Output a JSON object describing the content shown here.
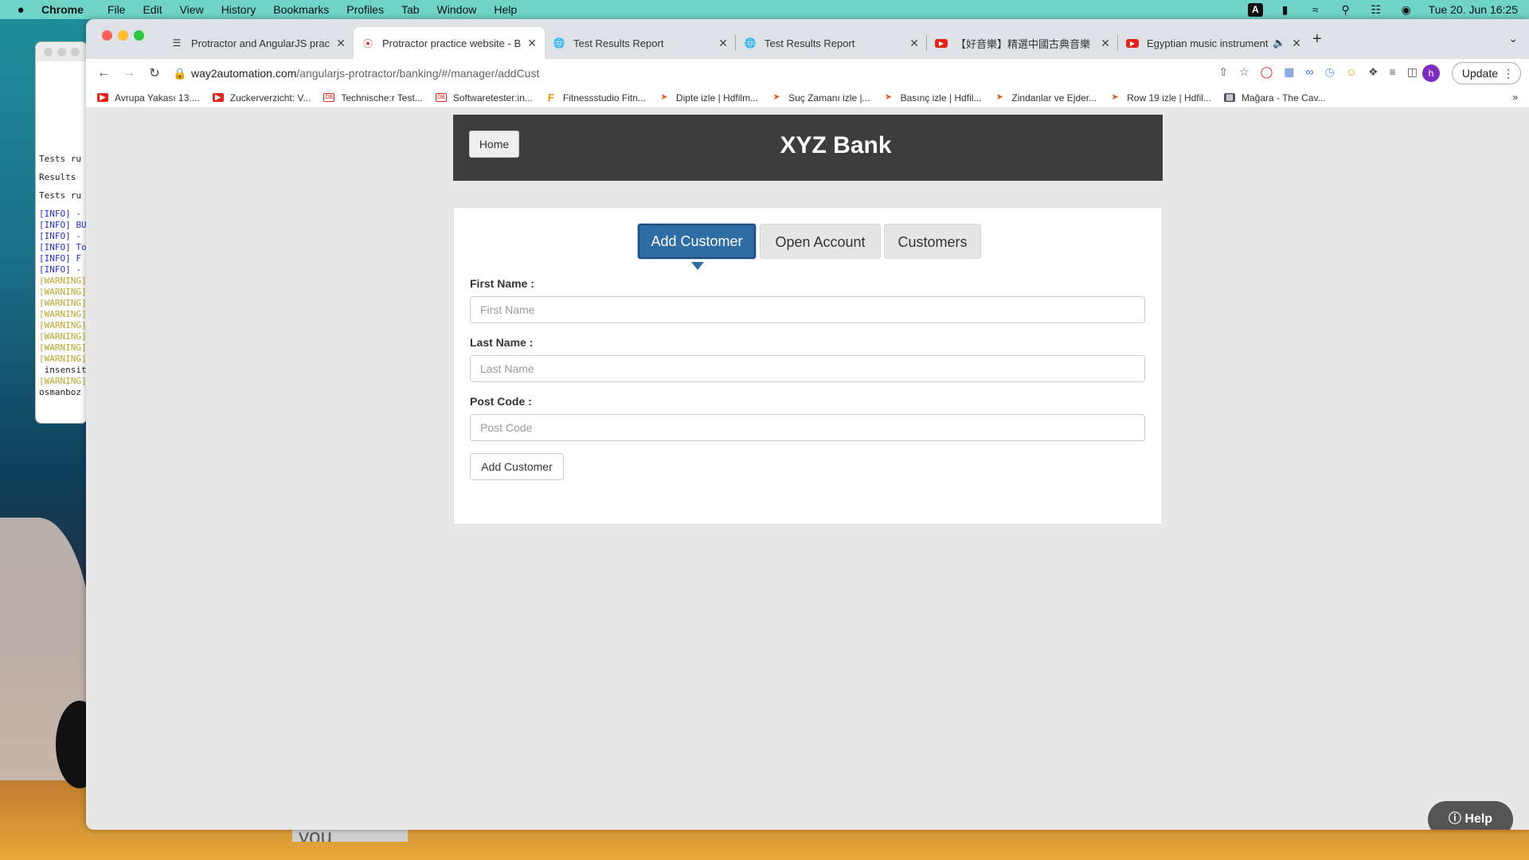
{
  "menubar": {
    "items": [
      "Chrome",
      "File",
      "Edit",
      "View",
      "History",
      "Bookmarks",
      "Profiles",
      "Tab",
      "Window",
      "Help"
    ],
    "input_badge": "A",
    "datetime": "Tue 20. Jun  16:25"
  },
  "terminal": {
    "lines": [
      "Tests ru",
      "Results",
      "Tests ru",
      "[INFO] -",
      "[INFO] BU",
      "[INFO] -",
      "[INFO] To",
      "[INFO] F",
      "[INFO] -",
      "[WARNING]",
      "[WARNING]",
      "[WARNING]",
      "[WARNING]",
      "[WARNING]",
      "[WARNING]",
      "[WARNING]",
      "[WARNING]",
      " insensit",
      "[WARNING]",
      "osmanboz"
    ]
  },
  "desktop": {
    "behind_text": "you"
  },
  "tabs": [
    {
      "title": "Protractor and AngularJS practi",
      "icon": "list-icon"
    },
    {
      "title": "Protractor practice website - B",
      "icon": "way2automation-icon",
      "active": true
    },
    {
      "title": "Test Results Report",
      "icon": "globe-icon"
    },
    {
      "title": "Test Results Report",
      "icon": "globe-icon"
    },
    {
      "title": "【好音樂】精選中國古典音樂（古",
      "icon": "youtube-icon"
    },
    {
      "title": "Egyptian music instrument",
      "icon": "youtube-icon",
      "muted": true
    }
  ],
  "address": {
    "host": "way2automation.com",
    "path": "/angularjs-protractor/banking/#/manager/addCust"
  },
  "profile_initial": "h",
  "update_label": "Update",
  "bookmarks": [
    {
      "label": "Avrupa Yakası 13....",
      "icon": "youtube-icon"
    },
    {
      "label": "Zuckerverzicht: V...",
      "icon": "youtube-icon"
    },
    {
      "label": "Technische:r Test...",
      "icon": "db-icon"
    },
    {
      "label": "Softwaretester:in...",
      "icon": "db-icon"
    },
    {
      "label": "Fitnessstudio Fitn...",
      "icon": "f-icon"
    },
    {
      "label": "Dipte izle | Hdfilm...",
      "icon": "hdfilm-icon"
    },
    {
      "label": "Suç Zamanı izle |...",
      "icon": "hdfilm-icon"
    },
    {
      "label": "Basınç izle | Hdfil...",
      "icon": "hdfilm-icon"
    },
    {
      "label": "Zindanlar ve Ejder...",
      "icon": "hdfilm-icon"
    },
    {
      "label": "Row 19 izle | Hdfil...",
      "icon": "hdfilm-icon"
    },
    {
      "label": "Mağara - The Cav...",
      "icon": "film-icon"
    }
  ],
  "bank": {
    "home_label": "Home",
    "title": "XYZ Bank",
    "nav": {
      "add": "Add Customer",
      "open": "Open Account",
      "customers": "Customers"
    },
    "form": {
      "first_label": "First Name :",
      "first_placeholder": "First Name",
      "last_label": "Last Name :",
      "last_placeholder": "Last Name",
      "post_label": "Post Code :",
      "post_placeholder": "Post Code",
      "submit": "Add Customer"
    },
    "help": "Help"
  },
  "colors": {
    "accent": "#2e6da4",
    "header_bg": "#3d3d3d",
    "menubar_bg": "#6fd3c8"
  }
}
